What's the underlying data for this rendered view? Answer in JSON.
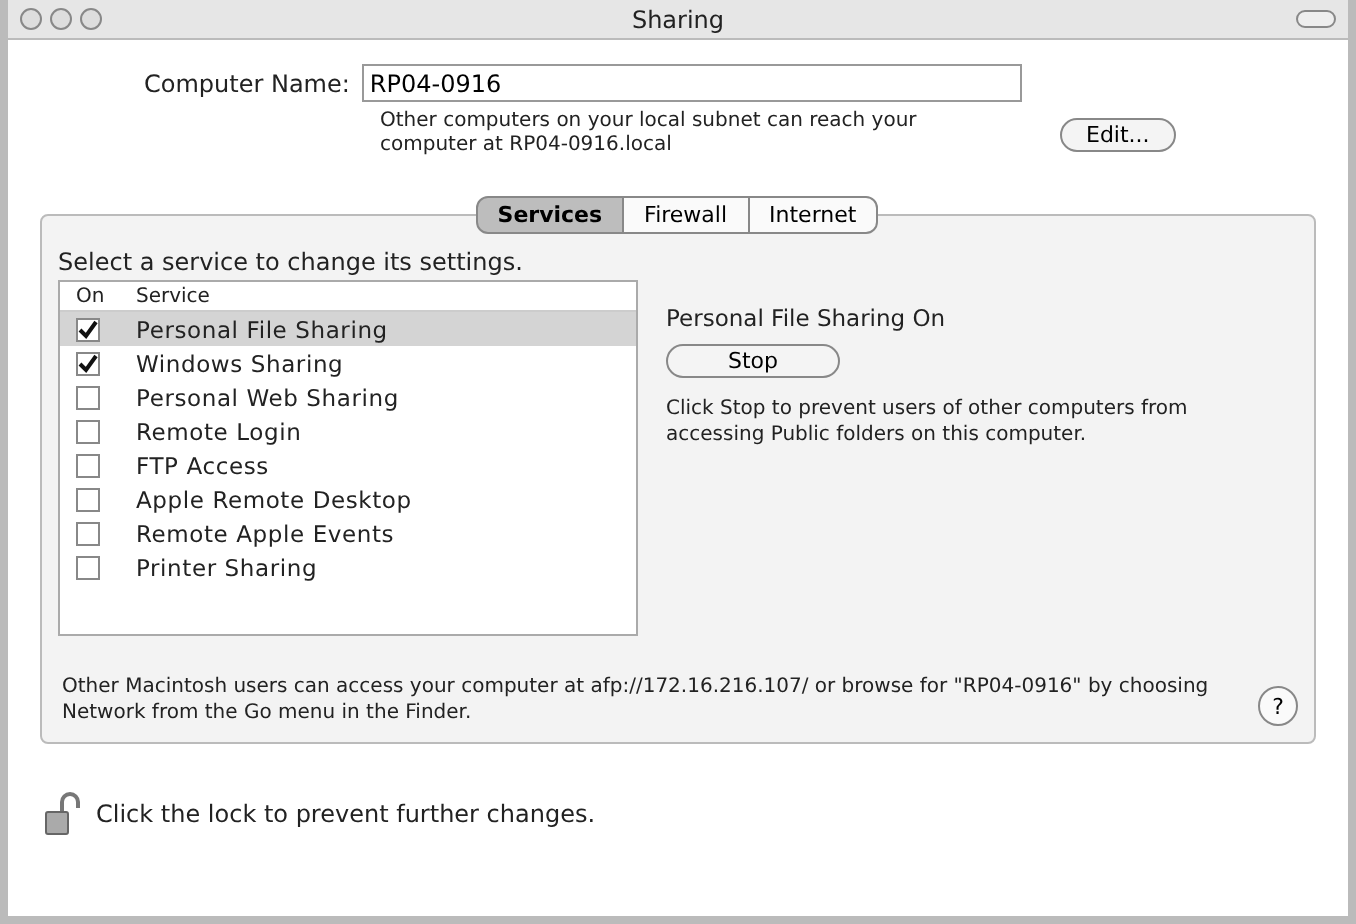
{
  "window": {
    "title": "Sharing"
  },
  "computer_name": {
    "label": "Computer Name:",
    "value": "RP04-0916",
    "note": "Other computers on your local subnet can reach your computer at RP04-0916.local",
    "edit_button": "Edit..."
  },
  "tabs": [
    {
      "label": "Services",
      "selected": true
    },
    {
      "label": "Firewall",
      "selected": false
    },
    {
      "label": "Internet",
      "selected": false
    }
  ],
  "services": {
    "prompt": "Select a service to change its settings.",
    "columns": [
      "On",
      "Service"
    ],
    "rows": [
      {
        "name": "Personal File Sharing",
        "checked": true,
        "selected": true
      },
      {
        "name": "Windows Sharing",
        "checked": true,
        "selected": false
      },
      {
        "name": "Personal Web Sharing",
        "checked": false,
        "selected": false
      },
      {
        "name": "Remote Login",
        "checked": false,
        "selected": false
      },
      {
        "name": "FTP Access",
        "checked": false,
        "selected": false
      },
      {
        "name": "Apple Remote Desktop",
        "checked": false,
        "selected": false
      },
      {
        "name": "Remote Apple Events",
        "checked": false,
        "selected": false
      },
      {
        "name": "Printer Sharing",
        "checked": false,
        "selected": false
      }
    ]
  },
  "detail": {
    "heading": "Personal File Sharing On",
    "button": "Stop",
    "description": "Click Stop to prevent users of other computers from accessing Public folders on this computer."
  },
  "footer_note": "Other Macintosh users can access your computer at afp://172.16.216.107/ or browse for \"RP04-0916\" by choosing Network from the Go menu in the Finder.",
  "help_button": "?",
  "lock_text": "Click the lock to prevent further changes."
}
